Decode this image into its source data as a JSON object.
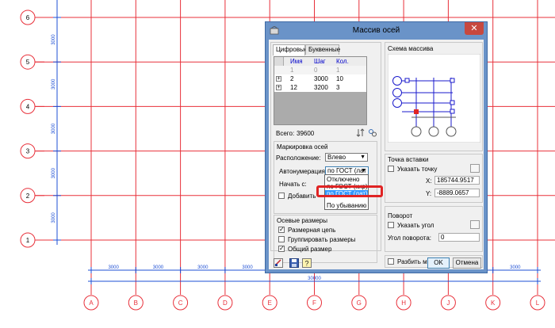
{
  "drawing": {
    "row_axes": [
      "1",
      "2",
      "3",
      "4",
      "5",
      "6"
    ],
    "row_spacings": [
      "3000",
      "3000",
      "3000",
      "3000",
      "3000"
    ],
    "col_axes": [
      "A",
      "B",
      "C",
      "D",
      "E",
      "F",
      "G",
      "H",
      "J",
      "K",
      "L"
    ],
    "col_spacings": [
      "3000",
      "3000",
      "3000",
      "3000",
      "3000",
      "3000",
      "3000",
      "3000",
      "3000",
      "3000"
    ],
    "total_dimension": "30000",
    "colors": {
      "grid_line": "#e8303a",
      "dimension": "#1e4fd4",
      "axis_bubble": "#e8303a"
    }
  },
  "dialog": {
    "title": "Массив осей",
    "tabs": [
      "Цифровые",
      "Буквенные"
    ],
    "table": {
      "headers": [
        "Имя",
        "Шаг",
        "Кол."
      ],
      "rows": [
        {
          "expander": "",
          "name": "1",
          "step": "0",
          "count": "1"
        },
        {
          "expander": "+",
          "name": "2",
          "step": "3000",
          "count": "10"
        },
        {
          "expander": "+",
          "name": "12",
          "step": "3200",
          "count": "3"
        }
      ]
    },
    "total_label": "Всего:",
    "total_value": "39600",
    "marking": {
      "group_title": "Маркировка осей",
      "position_label": "Расположение:",
      "position_value": "Влево",
      "autonumber_label": "Автонумерация:",
      "autonumber_value": "по ГОСТ (лат",
      "start_label": "Начать с:",
      "add_label": "Добавить",
      "dropdown_options": [
        "Отключено",
        "по ГОСТ (кир)",
        "по ГОСТ (лат)",
        "По убыванию"
      ],
      "dropdown_selected": 2
    },
    "dims": {
      "group_title": "Осевые размеры",
      "chain_label": "Размерная цепь",
      "chain_checked": true,
      "group_label": "Группировать размеры",
      "group_checked": false,
      "overall_label": "Общий размер",
      "overall_checked": true
    },
    "scheme_title": "Схема массива",
    "insert": {
      "group_title": "Точка вставки",
      "pick_label": "Указать точку",
      "x_label": "X:",
      "x_value": "185744.9517",
      "y_label": "Y:",
      "y_value": "-8889.0657"
    },
    "rotate": {
      "group_title": "Поворот",
      "pick_label": "Указать угол",
      "angle_label": "Угол поворота:",
      "angle_value": "0"
    },
    "break_label": "Разбить массив",
    "ok_label": "OK",
    "cancel_label": "Отмена",
    "close_glyph": "✕",
    "icons": [
      "app-icon",
      "sort-icon",
      "settings-icon",
      "pick-point-icon",
      "pick-angle-icon",
      "draw-icon",
      "save-icon",
      "help-icon"
    ]
  }
}
